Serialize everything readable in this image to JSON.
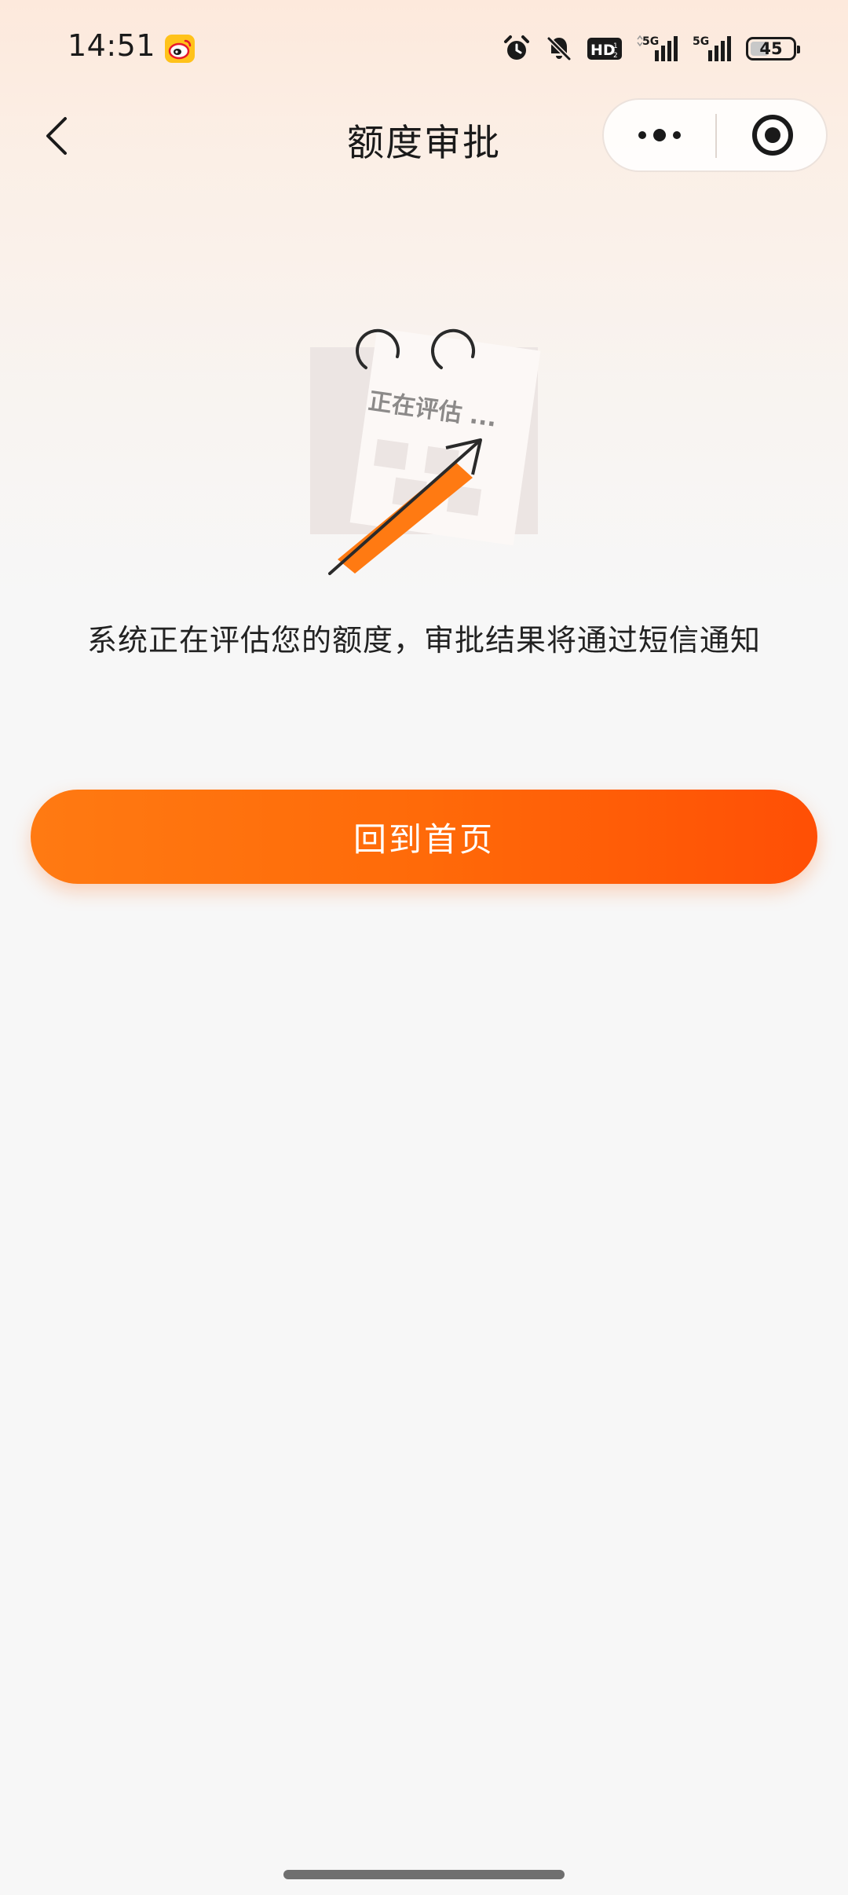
{
  "status_bar": {
    "time": "14:51",
    "battery": "45",
    "battery_level_percent": 45,
    "icons": [
      "weibo-icon",
      "alarm-icon",
      "bell-muted-icon",
      "hd-icon",
      "signal-5g-icon",
      "signal-5g-icon",
      "battery-icon"
    ],
    "hd_label": "HD",
    "network_1": "5G",
    "network_2": "5G"
  },
  "nav": {
    "title": "额度审批",
    "back_icon": "chevron-left-icon",
    "more_icon": "more-dots-icon",
    "close_icon": "target-close-icon"
  },
  "illustration": {
    "label": "正在评估 ..."
  },
  "main": {
    "message": "系统正在评估您的额度，审批结果将通过短信通知",
    "home_button_label": "回到首页"
  },
  "colors": {
    "accent_start": "#ff7a12",
    "accent_end": "#ff4f05",
    "text_primary": "#222222",
    "background": "#f7f7f7"
  }
}
